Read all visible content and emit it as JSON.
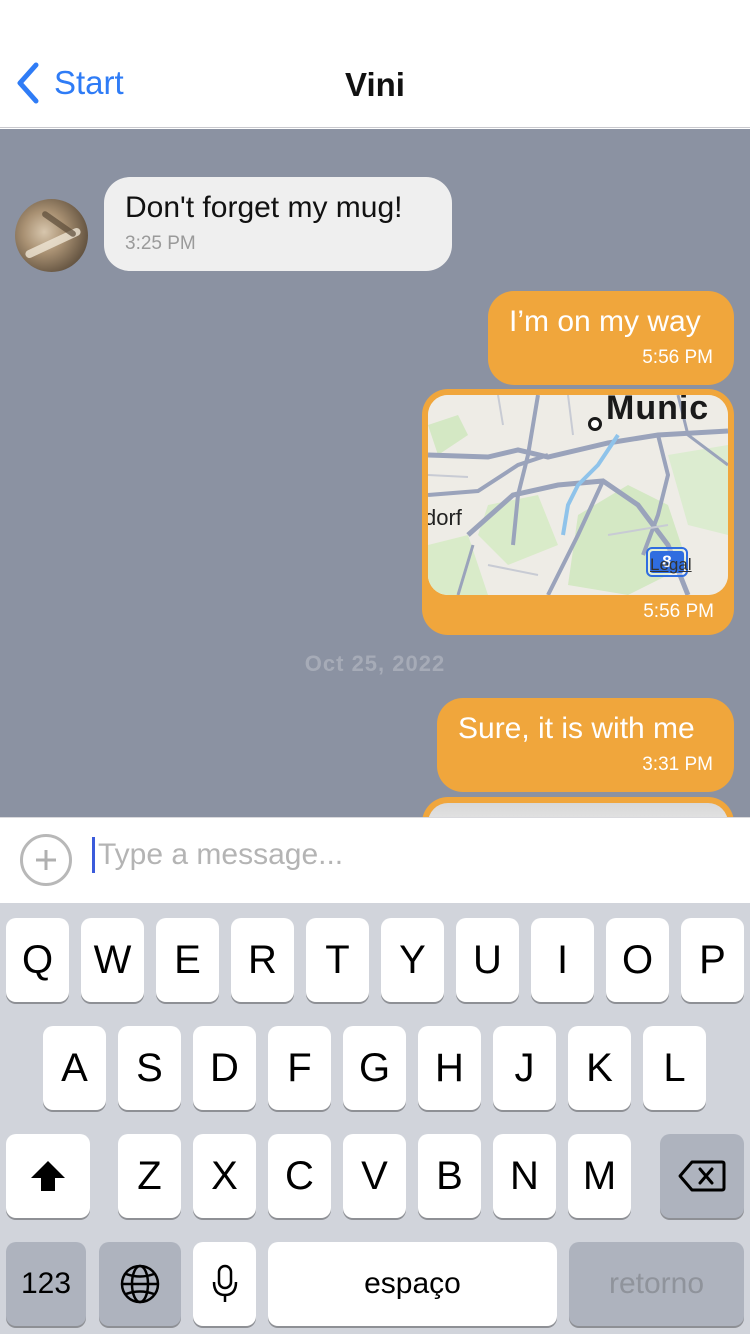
{
  "nav": {
    "back_label": "Start",
    "title": "Vini"
  },
  "chat": {
    "messages": [
      {
        "direction": "incoming",
        "text": "Don't forget my mug!",
        "time": "3:25 PM"
      },
      {
        "direction": "outgoing",
        "text": "I’m on my way",
        "time": "5:56 PM"
      },
      {
        "direction": "outgoing",
        "type": "map",
        "time": "5:56 PM",
        "map": {
          "city_label": "Munic",
          "town_label": "dorf",
          "highway_shield": "8",
          "legal_label": "Legal"
        }
      },
      {
        "direction": "outgoing",
        "text": "Sure, it is with me",
        "time": "3:31 PM"
      }
    ],
    "date_separator": "Oct 25, 2022"
  },
  "composer": {
    "placeholder": "Type a message...",
    "value": ""
  },
  "keyboard": {
    "row1": [
      "Q",
      "W",
      "E",
      "R",
      "T",
      "Y",
      "U",
      "I",
      "O",
      "P"
    ],
    "row2": [
      "A",
      "S",
      "D",
      "F",
      "G",
      "H",
      "J",
      "K",
      "L"
    ],
    "row3": [
      "Z",
      "X",
      "C",
      "V",
      "B",
      "N",
      "M"
    ],
    "numbers_label": "123",
    "space_label": "espaço",
    "return_label": "retorno"
  },
  "colors": {
    "accent": "#2f7cf6",
    "outgoing_bubble": "#f0a63c",
    "incoming_bubble": "#efefef",
    "chat_background": "#8b92a2",
    "keyboard_background": "#d1d4db"
  },
  "icons": {
    "back": "chevron-left-icon",
    "attach": "plus-circle-icon",
    "shift": "shift-icon",
    "delete": "backspace-icon",
    "globe": "globe-icon",
    "mic": "microphone-icon"
  }
}
